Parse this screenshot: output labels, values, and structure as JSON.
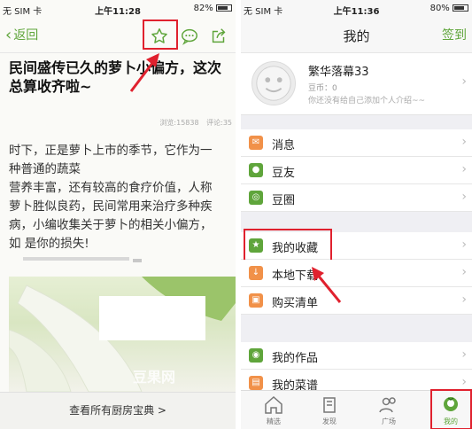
{
  "colors": {
    "brand_green": "#5fa53b",
    "highlight_red": "#e0212e"
  },
  "left": {
    "status": {
      "carrier": "无 SIM 卡",
      "time": "上午11:28",
      "battery": "82%",
      "battery_level": 0.82
    },
    "nav": {
      "back_label": "返回",
      "icons": [
        "star-icon",
        "comment-icon",
        "share-icon"
      ]
    },
    "article": {
      "title": "民间盛传已久的萝卜小偏方，这次总算收齐啦~",
      "views": "浏览:15838",
      "comments": "评论:35",
      "paragraph_lines": [
        "时下，正是萝卜上市的季节，它作为一",
        "种普通的蔬菜",
        "营养丰富，还有较高的食疗价值，人称",
        "萝卜胜似良药，民间常用来治疗多种疾",
        "病，小编收集关于萝卜的相关小偏方，",
        "如                      是你的损失!"
      ],
      "photo_watermark": "豆果网"
    },
    "bottom_link": "查看所有厨房宝典 >"
  },
  "right": {
    "status": {
      "carrier": "无 SIM 卡",
      "time": "上午11:36",
      "battery": "80%",
      "battery_level": 0.8
    },
    "nav": {
      "title": "我的",
      "checkin": "签到"
    },
    "profile": {
      "username": "繁华落幕33",
      "beans": "豆币：0",
      "intro": "你还没有给自己添加个人介绍~~"
    },
    "menu_groups": [
      [
        {
          "label": "消息",
          "icon": "envelope-icon",
          "color": "#f19149"
        },
        {
          "label": "豆友",
          "icon": "person-icon",
          "color": "#5fa53b"
        },
        {
          "label": "豆圈",
          "icon": "circle-icon",
          "color": "#5fa53b"
        }
      ],
      [
        {
          "label": "我的收藏",
          "icon": "star-icon",
          "color": "#5fa53b"
        },
        {
          "label": "本地下载",
          "icon": "download-icon",
          "color": "#f19149"
        },
        {
          "label": "购买清单",
          "icon": "gift-icon",
          "color": "#f19149"
        }
      ],
      [
        {
          "label": "我的作品",
          "icon": "camera-icon",
          "color": "#5fa53b"
        },
        {
          "label": "我的菜谱",
          "icon": "recipe-icon",
          "color": "#f19149"
        }
      ]
    ],
    "tabs": [
      {
        "label": "精选",
        "icon": "home-icon",
        "active": false
      },
      {
        "label": "发现",
        "icon": "discover-icon",
        "active": false
      },
      {
        "label": "广场",
        "icon": "people-icon",
        "active": false
      },
      {
        "label": "我的",
        "icon": "profile-icon",
        "active": true
      }
    ]
  }
}
